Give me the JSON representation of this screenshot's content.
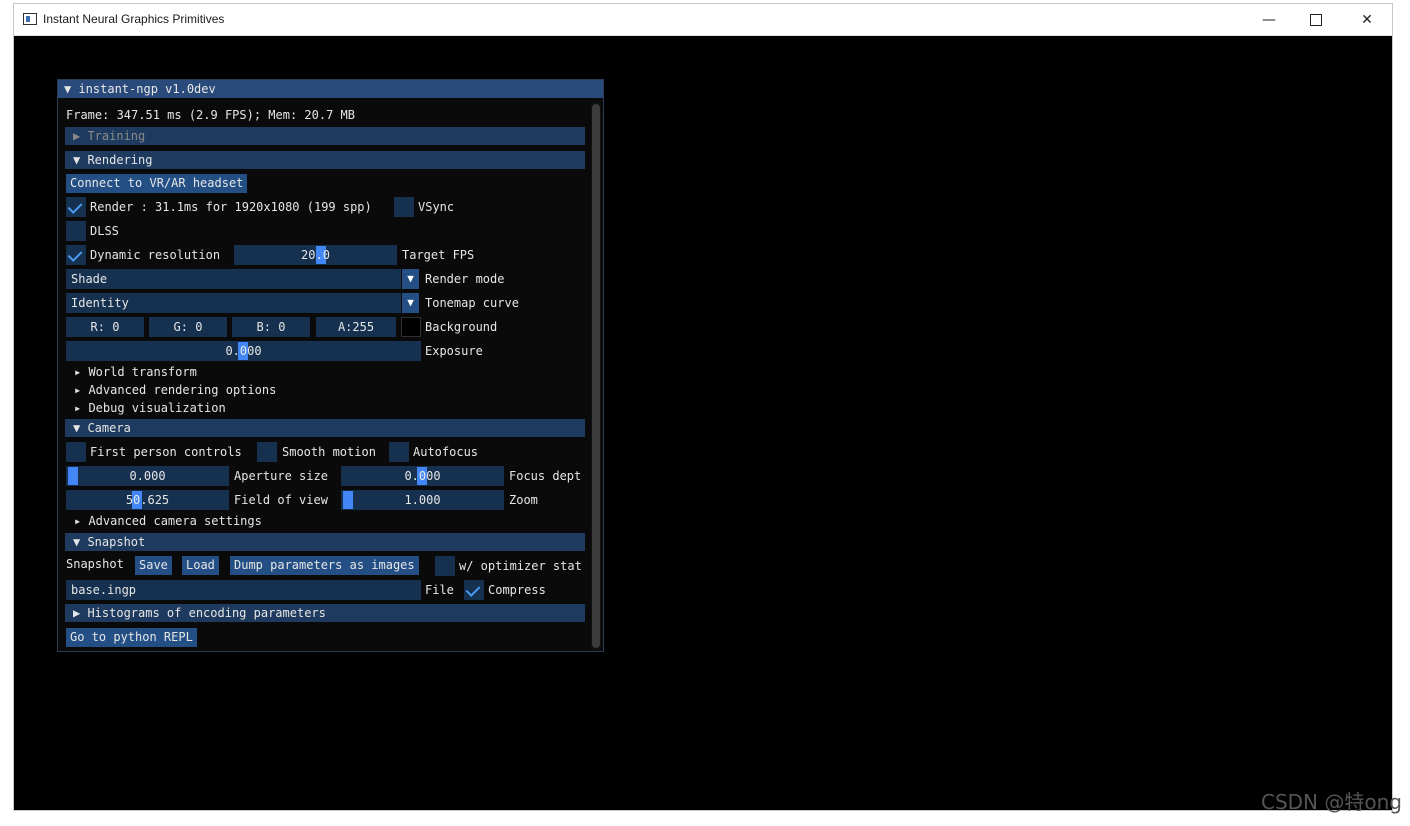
{
  "window": {
    "title": "Instant Neural Graphics Primitives",
    "minimize": "—",
    "close": "✕"
  },
  "panel": {
    "title": "▼ instant-ngp v1.0dev",
    "frame_info": "Frame: 347.51 ms (2.9 FPS); Mem: 20.7 MB",
    "training_header": "▶ Training",
    "rendering": {
      "header": "▼ Rendering",
      "connect_vr": "Connect to VR/AR headset",
      "render_label": "Render : 31.1ms for 1920x1080 (199 spp)",
      "vsync_label": "VSync",
      "dlss_label": "DLSS",
      "dynamic_res_label": "Dynamic resolution",
      "target_fps_value": "20.0",
      "target_fps_label": "Target FPS",
      "render_mode_value": "Shade",
      "render_mode_label": "Render mode",
      "tonemap_value": "Identity",
      "tonemap_label": "Tonemap curve",
      "bg_r": "R:  0",
      "bg_g": "G:  0",
      "bg_b": "B:  0",
      "bg_a": "A:255",
      "background_label": "Background",
      "exposure_value": "0.000",
      "exposure_label": "Exposure",
      "world_transform": "▸ World transform",
      "advanced_rendering": "▸ Advanced rendering options",
      "debug_vis": "▸ Debug visualization"
    },
    "camera": {
      "header": "▼ Camera",
      "first_person": "First person controls",
      "smooth_motion": "Smooth motion",
      "autofocus": "Autofocus",
      "aperture_value": "0.000",
      "aperture_label": "Aperture size",
      "focus_value": "0.000",
      "focus_label": "Focus dept",
      "fov_value": "50.625",
      "fov_label": "Field of view",
      "zoom_value": "1.000",
      "zoom_label": "Zoom",
      "advanced_camera": "▸ Advanced camera settings"
    },
    "snapshot": {
      "header": "▼ Snapshot",
      "label": "Snapshot",
      "save": "Save",
      "load": "Load",
      "dump": "Dump parameters as images",
      "optimizer_label": "w/ optimizer stat",
      "file_value": "base.ingp",
      "file_label": "File",
      "compress_label": "Compress"
    },
    "histograms_header": "▶ Histograms of encoding parameters",
    "python_repl": "Go to python REPL"
  },
  "watermark": "CSDN @特ong"
}
